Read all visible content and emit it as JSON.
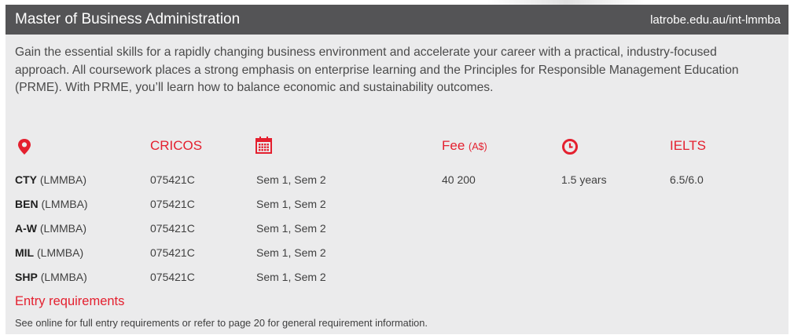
{
  "header": {
    "title": "Master of Business Administration",
    "url": "latrobe.edu.au/int-lmmba"
  },
  "intro": "Gain the essential skills for a rapidly changing business environment and accelerate your career with a practical, industry-focused approach. All coursework places a strong emphasis on enterprise learning and the Principles for Responsible Management Education (PRME). With PRME, you’ll learn how to balance economic and sustainability outcomes.",
  "columns": {
    "cricos": "CRICOS",
    "fee": "Fee",
    "fee_unit": "(A$)",
    "ielts": "IELTS"
  },
  "icons": {
    "location": "location-pin-icon",
    "intake": "calendar-icon",
    "duration": "clock-icon",
    "accent_color": "#e4202f"
  },
  "rows": [
    {
      "campus": "CTY",
      "course_code": "(LMMBA)",
      "cricos": "075421C",
      "intakes": "Sem 1, Sem 2"
    },
    {
      "campus": "BEN",
      "course_code": "(LMMBA)",
      "cricos": "075421C",
      "intakes": "Sem 1, Sem 2"
    },
    {
      "campus": "A-W",
      "course_code": "(LMMBA)",
      "cricos": "075421C",
      "intakes": "Sem 1, Sem 2"
    },
    {
      "campus": "MIL",
      "course_code": "(LMMBA)",
      "cricos": "075421C",
      "intakes": "Sem 1, Sem 2"
    },
    {
      "campus": "SHP",
      "course_code": "(LMMBA)",
      "cricos": "075421C",
      "intakes": "Sem 1, Sem 2"
    }
  ],
  "fee": "40 200",
  "duration": "1.5 years",
  "ielts": "6.5/6.0",
  "entry": {
    "title": "Entry requirements",
    "text": "See online for full entry requirements or refer to page 20 for general requirement information."
  }
}
